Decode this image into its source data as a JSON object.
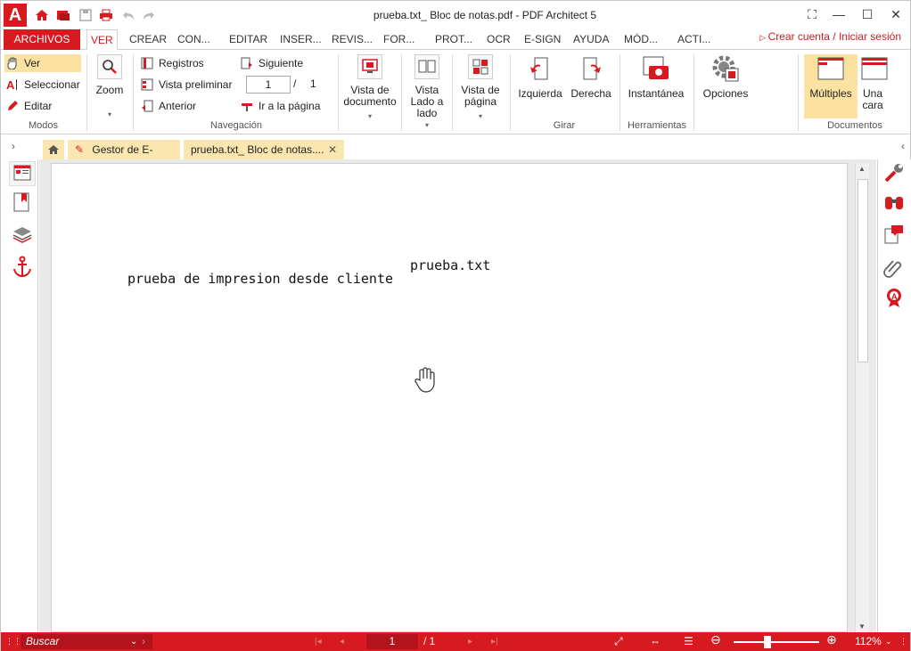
{
  "app": {
    "window_title": "prueba.txt_ Bloc de notas.pdf   -   PDF Architect 5",
    "brand_color": "#d71920"
  },
  "menu": {
    "file_tab": "ARCHIVOS",
    "tabs": [
      "VER",
      "CREAR",
      "CON...",
      "EDITAR",
      "INSER...",
      "REVIS...",
      "FOR...",
      "PROT...",
      "OCR",
      "E-SIGN",
      "AYUDA",
      "MÓD...",
      "ACTI..."
    ],
    "active_tab": "VER",
    "account_link": "Crear cuenta / Iniciar sesión"
  },
  "ribbon": {
    "modos": {
      "label": "Modos",
      "items": [
        "Ver",
        "Seleccionar",
        "Editar"
      ]
    },
    "zoom": {
      "label": "Zoom"
    },
    "navegacion": {
      "label": "Navegación",
      "registros": "Registros",
      "vista_preliminar": "Vista preliminar",
      "anterior": "Anterior",
      "siguiente": "Siguiente",
      "page_current": "1",
      "page_sep": "/",
      "page_total": "1",
      "ir_pagina": "Ir a la página"
    },
    "vista_documento": "Vista de documento",
    "vista_lado": "Vista Lado a lado",
    "vista_pagina": "Vista de página",
    "girar": {
      "label": "Girar",
      "izquierda": "Izquierda",
      "derecha": "Derecha"
    },
    "herramientas": {
      "label": "Herramientas",
      "instantanea": "Instantánea"
    },
    "opciones": "Opciones",
    "documentos": {
      "label": "Documentos",
      "multiples": "Múltiples",
      "una_cara": "Una cara"
    }
  },
  "doc_tabs": {
    "esign": "Gestor de E-Sign",
    "current": "prueba.txt_ Bloc de notas...."
  },
  "page_content": {
    "header_text": "prueba.txt",
    "body_text": "prueba de impresion desde cliente"
  },
  "statusbar": {
    "search_placeholder": "Buscar",
    "page_current": "1",
    "page_total": "/ 1",
    "zoom": "112%"
  }
}
